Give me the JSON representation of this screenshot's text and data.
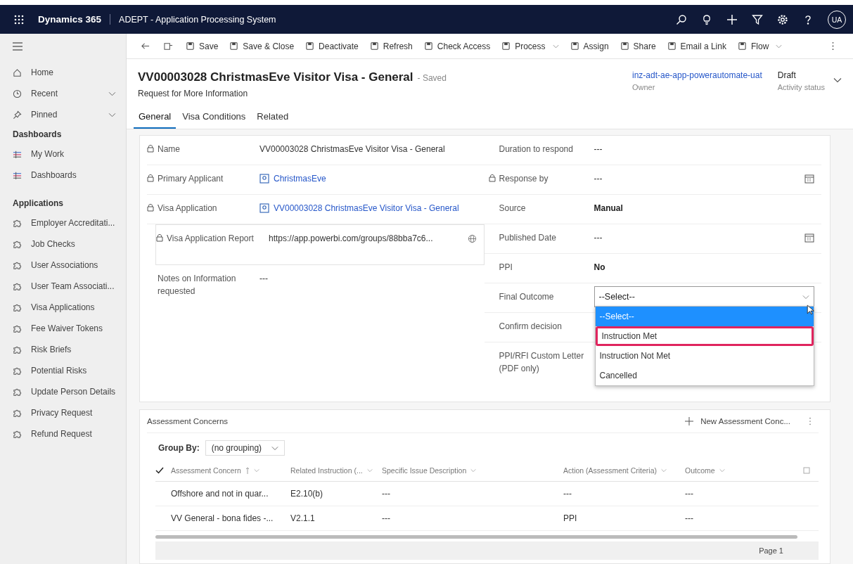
{
  "top_bar": {
    "app_name": "Dynamics 365",
    "system_name": "ADEPT - Application Processing System",
    "avatar": "UA"
  },
  "sidebar": {
    "nav": [
      {
        "label": "Home",
        "expandable": false
      },
      {
        "label": "Recent",
        "expandable": true
      },
      {
        "label": "Pinned",
        "expandable": true
      }
    ],
    "groups": [
      {
        "title": "Dashboards",
        "items": [
          "My Work",
          "Dashboards"
        ]
      },
      {
        "title": "Applications",
        "items": [
          "Employer Accreditati...",
          "Job Checks",
          "User Associations",
          "User Team Associati...",
          "Visa Applications",
          "Fee Waiver Tokens",
          "Risk Briefs",
          "Potential Risks",
          "Update Person Details",
          "Privacy Request",
          "Refund Request"
        ]
      }
    ]
  },
  "command_bar": [
    {
      "label": "Save",
      "menu": false
    },
    {
      "label": "Save & Close",
      "menu": false
    },
    {
      "label": "Deactivate",
      "menu": false
    },
    {
      "label": "Refresh",
      "menu": false
    },
    {
      "label": "Check Access",
      "menu": false
    },
    {
      "label": "Process",
      "menu": true
    },
    {
      "label": "Assign",
      "menu": false
    },
    {
      "label": "Share",
      "menu": false
    },
    {
      "label": "Email a Link",
      "menu": false
    },
    {
      "label": "Flow",
      "menu": true
    }
  ],
  "record": {
    "title": "VV00003028 ChristmasEve Visitor Visa - General",
    "save_state": "- Saved",
    "entity": "Request for More Information",
    "owner": {
      "value": "inz-adt-ae-app-powerautomate-uat",
      "label": "Owner"
    },
    "status": {
      "value": "Draft",
      "label": "Activity status"
    }
  },
  "tabs": [
    {
      "label": "General",
      "selected": true
    },
    {
      "label": "Visa Conditions",
      "selected": false
    },
    {
      "label": "Related",
      "selected": false
    }
  ],
  "left_fields": [
    {
      "label": "Name",
      "locked": true,
      "kind": "text",
      "value": "VV00003028 ChristmasEve Visitor Visa - General"
    },
    {
      "label": "Primary Applicant",
      "locked": true,
      "kind": "lookup",
      "value": "ChristmasEve"
    },
    {
      "label": "Visa Application",
      "locked": true,
      "kind": "lookup",
      "value": "VV00003028 ChristmasEve Visitor Visa - General"
    },
    {
      "label": "Visa Application Report",
      "locked": true,
      "kind": "url",
      "value": "https://app.powerbi.com/groups/88bba7c6..."
    },
    {
      "label": "Notes on Information requested",
      "locked": false,
      "kind": "text",
      "value": "---"
    }
  ],
  "right_fields": [
    {
      "label": "Duration to respond",
      "locked": false,
      "kind": "text",
      "value": "---"
    },
    {
      "label": "Response by",
      "locked": true,
      "kind": "date",
      "value": "---"
    },
    {
      "label": "Source",
      "locked": false,
      "kind": "bold",
      "value": "Manual"
    },
    {
      "label": "Published Date",
      "locked": false,
      "kind": "date",
      "value": "---"
    },
    {
      "label": "PPI",
      "locked": false,
      "kind": "bold",
      "value": "No"
    },
    {
      "label": "Final Outcome",
      "locked": false,
      "kind": "select",
      "value": "--Select--"
    },
    {
      "label": "Confirm decision",
      "locked": false,
      "kind": "covered"
    },
    {
      "label": "PPI/RFI Custom Letter (PDF only)",
      "locked": false,
      "kind": "covered"
    }
  ],
  "dropdown_options": [
    {
      "label": "--Select--",
      "selected": true,
      "outlined": false
    },
    {
      "label": "Instruction Met",
      "selected": false,
      "outlined": true
    },
    {
      "label": "Instruction Not Met",
      "selected": false,
      "outlined": false
    },
    {
      "label": "Cancelled",
      "selected": false,
      "outlined": false
    }
  ],
  "subgrid": {
    "title": "Assessment Concerns",
    "new_button": "New Assessment Conc...",
    "group_by_label": "Group By:",
    "group_by_value": "(no grouping)",
    "columns": [
      "Assessment Concern",
      "Related Instruction (...",
      "Specific Issue Description",
      "Action (Assessment Criteria)",
      "Outcome"
    ],
    "rows": [
      [
        "Offshore and not in quar...",
        "E2.10(b)",
        "---",
        "---",
        "---"
      ],
      [
        "VV General - bona fides -...",
        "V2.1.1",
        "---",
        "PPI",
        "---"
      ]
    ],
    "page": "Page 1"
  }
}
